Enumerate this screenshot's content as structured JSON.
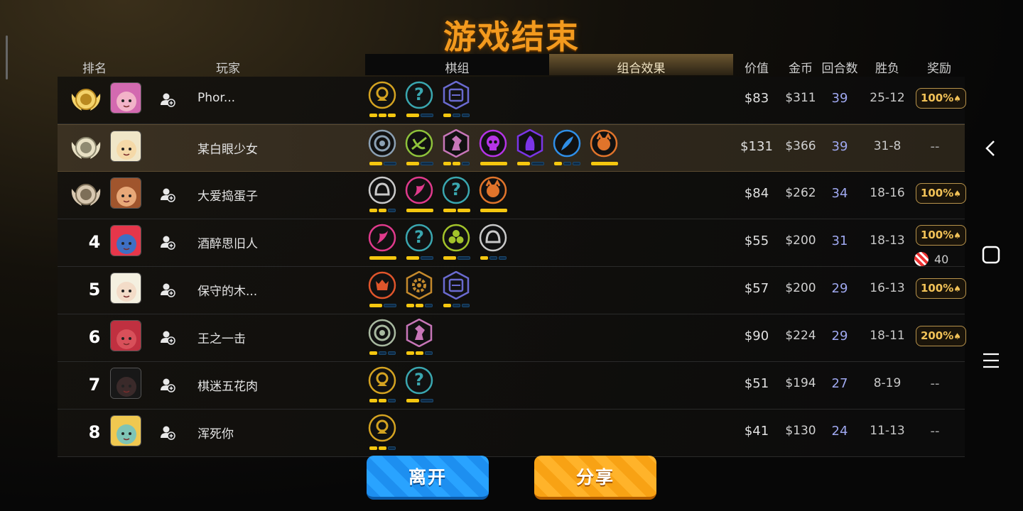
{
  "title": "游戏结束",
  "headers": {
    "rank": "排名",
    "player": "玩家",
    "tab_deck": "棋组",
    "tab_synergy": "组合效果",
    "value": "价值",
    "gold": "金币",
    "rounds": "回合数",
    "winloss": "胜负",
    "reward": "奖励"
  },
  "players": [
    {
      "rank": "1",
      "medal": "gold",
      "name": "Phor...",
      "price": "$83",
      "gold": "$311",
      "rounds": "39",
      "wl": "25-12",
      "reward": "100%",
      "add": true,
      "traits": [
        {
          "c": "#d4a321",
          "g": "coin",
          "p": [
            1,
            1,
            1
          ]
        },
        {
          "c": "#3aa7b0",
          "g": "q",
          "p": [
            1,
            0
          ]
        },
        {
          "c": "#6a6ad0",
          "g": "tab",
          "p": [
            1,
            0,
            0
          ]
        }
      ]
    },
    {
      "rank": "2",
      "medal": "silver",
      "name": "某白眼少女",
      "price": "$131",
      "gold": "$366",
      "rounds": "39",
      "wl": "31-8",
      "reward": "--",
      "add": false,
      "highlight": true,
      "traits": [
        {
          "c": "#8ba0b3",
          "g": "ring",
          "p": [
            1,
            0
          ]
        },
        {
          "c": "#8ec23a",
          "g": "bow",
          "p": [
            1,
            0
          ]
        },
        {
          "c": "#c776b8",
          "g": "knight",
          "p": [
            1,
            1,
            0
          ]
        },
        {
          "c": "#b534e6",
          "g": "skull",
          "p": [
            2
          ]
        },
        {
          "c": "#7b35e6",
          "g": "mage",
          "p": [
            1,
            0
          ]
        },
        {
          "c": "#2f8fe8",
          "g": "feather",
          "p": [
            1,
            0,
            0
          ]
        },
        {
          "c": "#e0742b",
          "g": "beast",
          "p": [
            2
          ]
        }
      ]
    },
    {
      "rank": "3",
      "medal": "bronze",
      "name": "大爱捣蛋子",
      "price": "$84",
      "gold": "$262",
      "rounds": "34",
      "wl": "18-16",
      "reward": "100%",
      "add": true,
      "traits": [
        {
          "c": "#c9c9c9",
          "g": "helmet",
          "p": [
            1,
            1,
            0
          ]
        },
        {
          "c": "#e03a8c",
          "g": "dragon",
          "p": [
            3
          ]
        },
        {
          "c": "#3aa7b0",
          "g": "q",
          "p": [
            1,
            1
          ]
        },
        {
          "c": "#e0742b",
          "g": "beast",
          "p": [
            2
          ]
        }
      ]
    },
    {
      "rank": "4",
      "medal": "",
      "name": "酒醉思旧人",
      "price": "$55",
      "gold": "$200",
      "rounds": "31",
      "wl": "18-13",
      "reward": "100%",
      "candy": "40",
      "add": true,
      "traits": [
        {
          "c": "#e03a8c",
          "g": "dragon",
          "p": [
            3
          ]
        },
        {
          "c": "#3aa7b0",
          "g": "q",
          "p": [
            1,
            0
          ]
        },
        {
          "c": "#a3c42a",
          "g": "clover",
          "p": [
            1,
            0
          ]
        },
        {
          "c": "#c9c9c9",
          "g": "helmet",
          "p": [
            1,
            0,
            0
          ]
        }
      ]
    },
    {
      "rank": "5",
      "medal": "",
      "name": "保守的木...",
      "price": "$57",
      "gold": "$200",
      "rounds": "29",
      "wl": "16-13",
      "reward": "100%",
      "add": true,
      "traits": [
        {
          "c": "#e0552b",
          "g": "demon",
          "p": [
            1,
            0
          ]
        },
        {
          "c": "#c58a2c",
          "g": "gear",
          "p": [
            1,
            1,
            0
          ]
        },
        {
          "c": "#6a6ad0",
          "g": "tab",
          "p": [
            1,
            0,
            0
          ]
        }
      ]
    },
    {
      "rank": "6",
      "medal": "",
      "name": "王之一击",
      "price": "$90",
      "gold": "$224",
      "rounds": "29",
      "wl": "18-11",
      "reward": "200%",
      "add": true,
      "traits": [
        {
          "c": "#a8b9a0",
          "g": "ring",
          "p": [
            1,
            0,
            0
          ]
        },
        {
          "c": "#c776b8",
          "g": "knight",
          "p": [
            1,
            1,
            0
          ]
        }
      ]
    },
    {
      "rank": "7",
      "medal": "",
      "name": "棋迷五花肉",
      "price": "$51",
      "gold": "$194",
      "rounds": "27",
      "wl": "8-19",
      "reward": "--",
      "add": true,
      "traits": [
        {
          "c": "#d4a321",
          "g": "coin",
          "p": [
            1,
            1,
            0
          ]
        },
        {
          "c": "#3aa7b0",
          "g": "q",
          "p": [
            1,
            0
          ]
        }
      ]
    },
    {
      "rank": "8",
      "medal": "",
      "name": "浑死你",
      "price": "$41",
      "gold": "$130",
      "rounds": "24",
      "wl": "11-13",
      "reward": "--",
      "add": true,
      "traits": [
        {
          "c": "#d4a321",
          "g": "coin",
          "p": [
            1,
            1,
            0
          ]
        }
      ]
    }
  ],
  "buttons": {
    "leave": "离开",
    "share": "分享"
  },
  "colors": {
    "title": "#f39a1e",
    "pip_on": "#f5c70f",
    "rounds_text": "#9fa8f0",
    "reward_text": "#f2c257"
  }
}
